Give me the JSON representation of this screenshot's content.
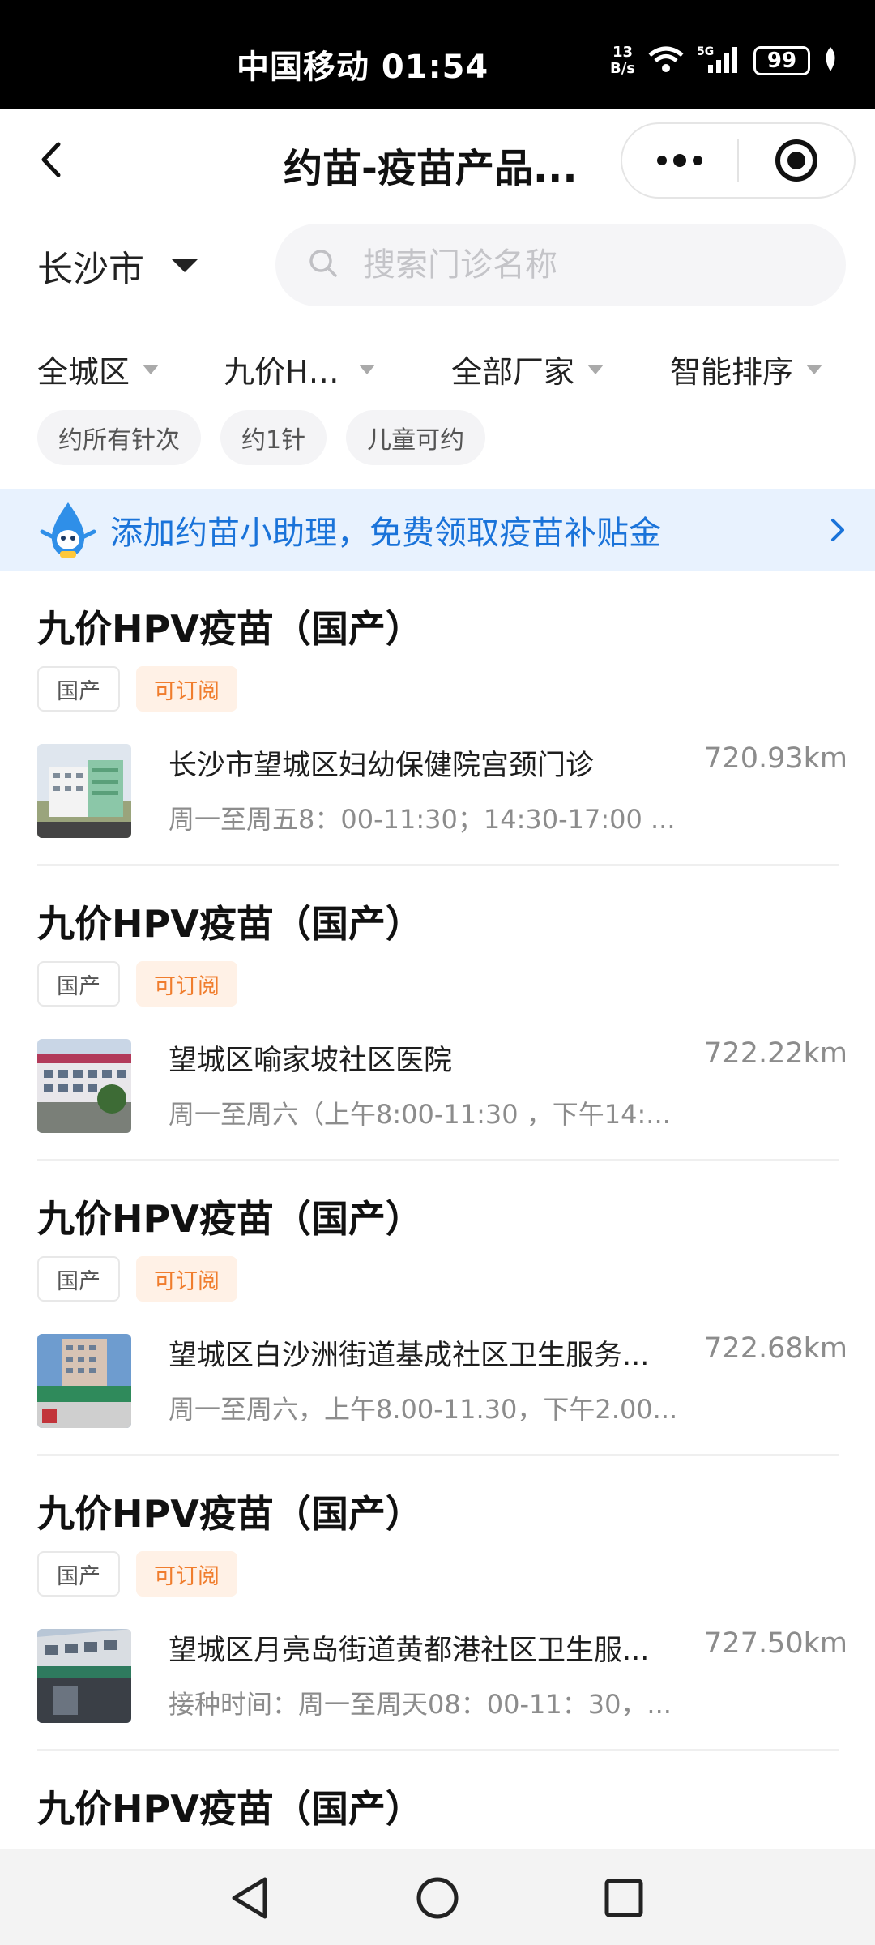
{
  "status_bar": {
    "carrier_time": "中国移动 01:54",
    "net_speed_value": "13",
    "net_speed_unit": "B/s",
    "battery": "99",
    "icons": [
      "wifi-icon",
      "signal-5g-icon",
      "battery-icon",
      "leaf-icon"
    ]
  },
  "nav": {
    "title": "约苗-疫苗产品...",
    "icons": [
      "back-chevron-icon",
      "more-dots-icon",
      "target-circle-icon"
    ]
  },
  "location": {
    "city": "长沙市"
  },
  "search": {
    "placeholder": "搜索门诊名称"
  },
  "filters": [
    {
      "label": "全城区"
    },
    {
      "label": "九价H…"
    },
    {
      "label": "全部厂家"
    },
    {
      "label": "智能排序"
    }
  ],
  "chips": [
    "约所有针次",
    "约1针",
    "儿童可约"
  ],
  "banner": {
    "text": "添加约苗小助理，免费领取疫苗补贴金"
  },
  "items": [
    {
      "title": "九价HPV疫苗（国产）",
      "tag_domestic": "国产",
      "tag_subscribe": "可订阅",
      "clinic": "长沙市望城区妇幼保健院宫颈门诊",
      "hours": "周一至周五8：00-11:30；14:30-17:00 ...",
      "distance": "720.93km"
    },
    {
      "title": "九价HPV疫苗（国产）",
      "tag_domestic": "国产",
      "tag_subscribe": "可订阅",
      "clinic": "望城区喻家坡社区医院",
      "hours": "周一至周六（上午8:00-11:30 ，下午14:...",
      "distance": "722.22km"
    },
    {
      "title": "九价HPV疫苗（国产）",
      "tag_domestic": "国产",
      "tag_subscribe": "可订阅",
      "clinic": "望城区白沙洲街道基成社区卫生服务...",
      "hours": "周一至周六，上午8.00-11.30，下午2.00...",
      "distance": "722.68km"
    },
    {
      "title": "九价HPV疫苗（国产）",
      "tag_domestic": "国产",
      "tag_subscribe": "可订阅",
      "clinic": "望城区月亮岛街道黄都港社区卫生服...",
      "hours": "接种时间：周一至周天08：00-11：30，...",
      "distance": "727.50km"
    }
  ],
  "partial_item": {
    "title": "九价HPV疫苗（国产）"
  },
  "colors": {
    "accent_blue": "#1a73d9",
    "banner_bg": "#e8f2fe",
    "subscribe_orange": "#f07d2d",
    "subscribe_bg": "#fff1e6"
  }
}
